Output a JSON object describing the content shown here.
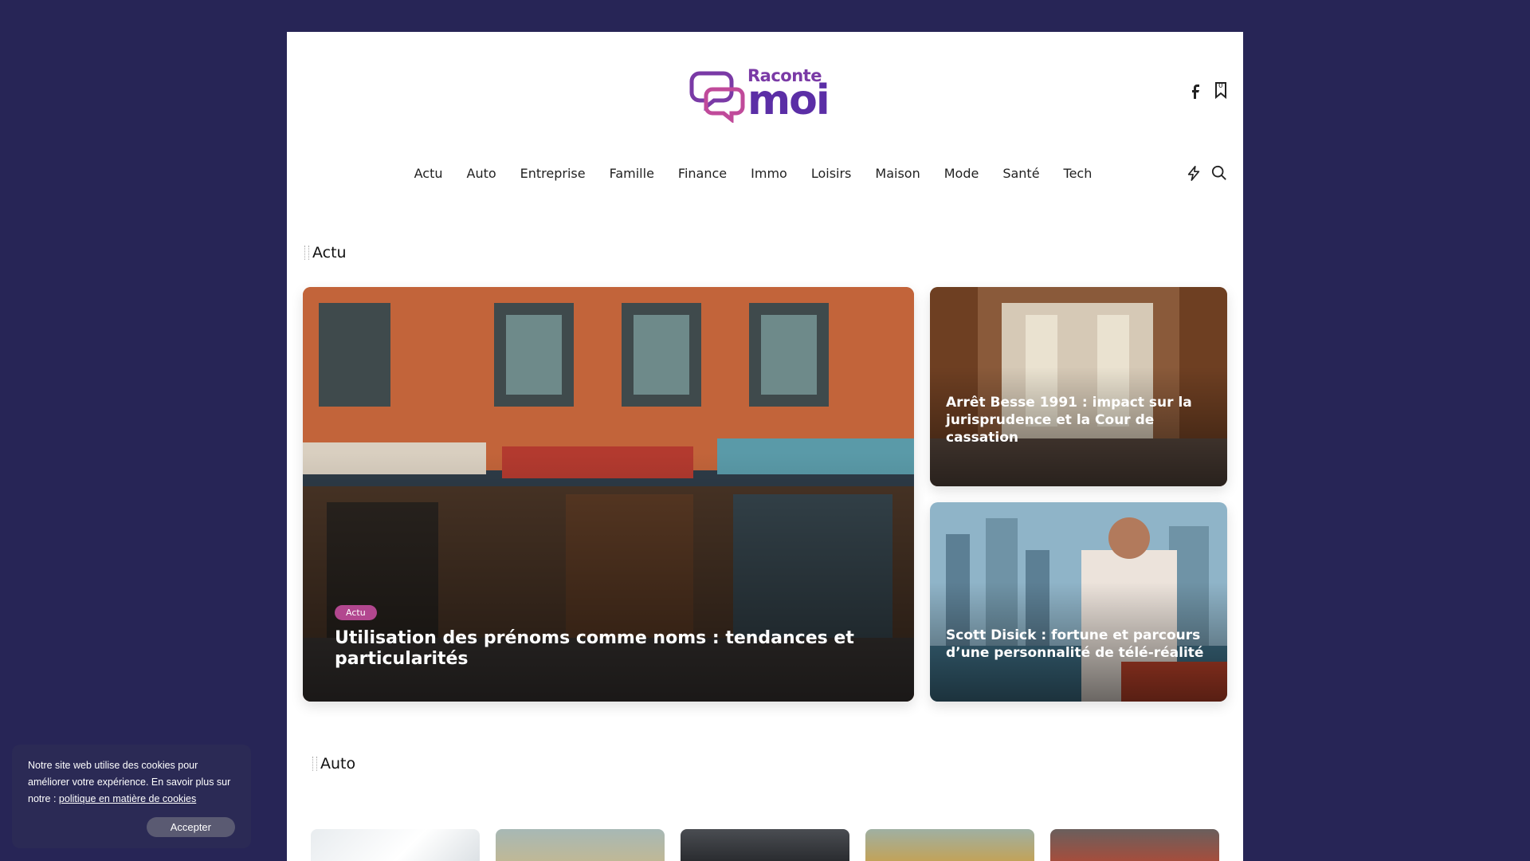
{
  "site": {
    "logo_top": "Raconte",
    "logo_bottom": "moi"
  },
  "header": {
    "bookmark_count": "0",
    "icons": [
      "facebook-icon",
      "bookmark-icon",
      "flash-icon",
      "search-icon"
    ]
  },
  "nav": {
    "items": [
      "Actu",
      "Auto",
      "Entreprise",
      "Famille",
      "Finance",
      "Immo",
      "Loisirs",
      "Maison",
      "Mode",
      "Santé",
      "Tech"
    ]
  },
  "sections": {
    "actu_title": "Actu",
    "auto_title": "Auto"
  },
  "featured": {
    "main": {
      "badge": "Actu",
      "title": "Utilisation des prénoms comme noms : tendances et particularités"
    },
    "side1": {
      "title": "Arrêt Besse 1991 : impact sur la jurisprudence et la Cour de cassation"
    },
    "side2": {
      "title": "Scott Disick : fortune et parcours d’une personnalité de télé-réalité"
    }
  },
  "cookie": {
    "text": "Notre site web utilise des cookies pour améliorer votre expérience. En savoir plus sur notre : ",
    "link": "politique en matière de cookies",
    "accept": "Accepter"
  },
  "colors": {
    "background": "#272556",
    "accent": "#5b2ea6",
    "badge": "#b2478f"
  }
}
